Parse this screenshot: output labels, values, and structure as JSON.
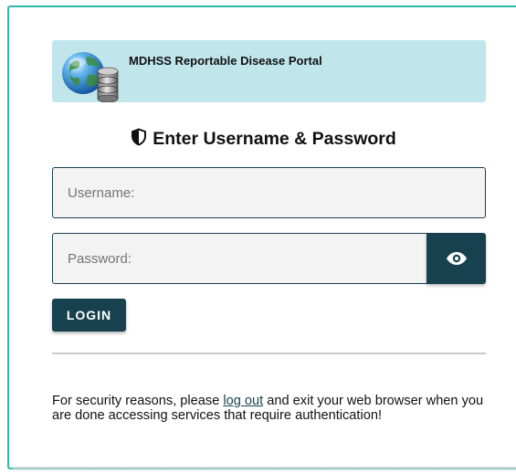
{
  "banner": {
    "logo_icon": "globe-database-icon",
    "title": "MDHSS Reportable Disease Portal"
  },
  "heading": {
    "icon": "shield-icon",
    "text": "Enter Username & Password"
  },
  "form": {
    "username_placeholder": "Username:",
    "username_value": "",
    "password_placeholder": "Password:",
    "password_value": "",
    "show_password_icon": "eye-icon",
    "login_label": "LOGIN"
  },
  "notice": {
    "before": "For security reasons, please ",
    "link": "log out",
    "after": " and exit your web browser when you are done accessing services that require authentication!"
  },
  "colors": {
    "accent": "#17414f",
    "banner_bg": "#c0e6ec",
    "panel_border": "#2eb8aa"
  }
}
